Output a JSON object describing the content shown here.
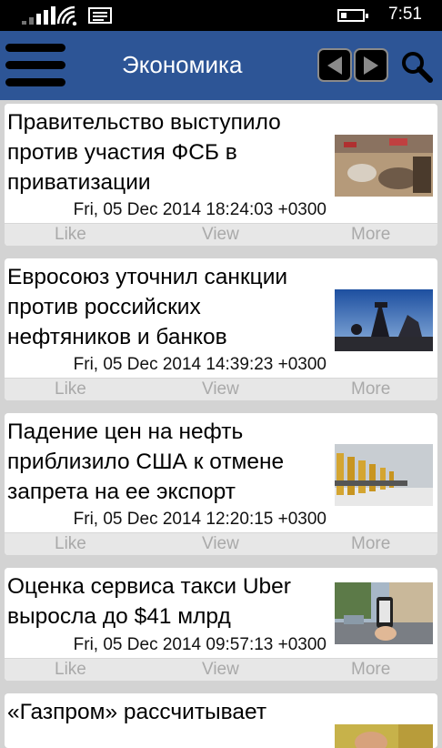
{
  "status": {
    "time": "7:51"
  },
  "header": {
    "title": "Экономика"
  },
  "icons": {
    "menu": "hamburger-menu-icon",
    "prev": "arrow-left-icon",
    "next": "arrow-right-icon",
    "search": "search-icon"
  },
  "colors": {
    "header": "#2d5596",
    "background": "#d3d3d3",
    "action_text": "#a9a9a9"
  },
  "actions": {
    "like": "Like",
    "view": "View",
    "more": "More"
  },
  "articles": [
    {
      "lines": [
        "Правительство выступило",
        "против участия ФСБ в",
        "приватизации"
      ],
      "date": "Fri, 05 Dec 2014 18:24:03 +0300"
    },
    {
      "lines": [
        "Евросоюз уточнил санкции",
        "против российских",
        "нефтяников и банков"
      ],
      "date": "Fri, 05 Dec 2014 14:39:23 +0300"
    },
    {
      "lines": [
        "Падение цен на нефть",
        "приблизило США к отмене",
        "запрета на ее экспорт"
      ],
      "date": "Fri, 05 Dec 2014 12:20:15 +0300"
    },
    {
      "lines": [
        "Оценка сервиса такси Uber",
        "выросла до $41 млрд"
      ],
      "date": "Fri, 05 Dec 2014 09:57:13 +0300"
    },
    {
      "lines": [
        "«Газпром» рассчитывает"
      ]
    }
  ]
}
